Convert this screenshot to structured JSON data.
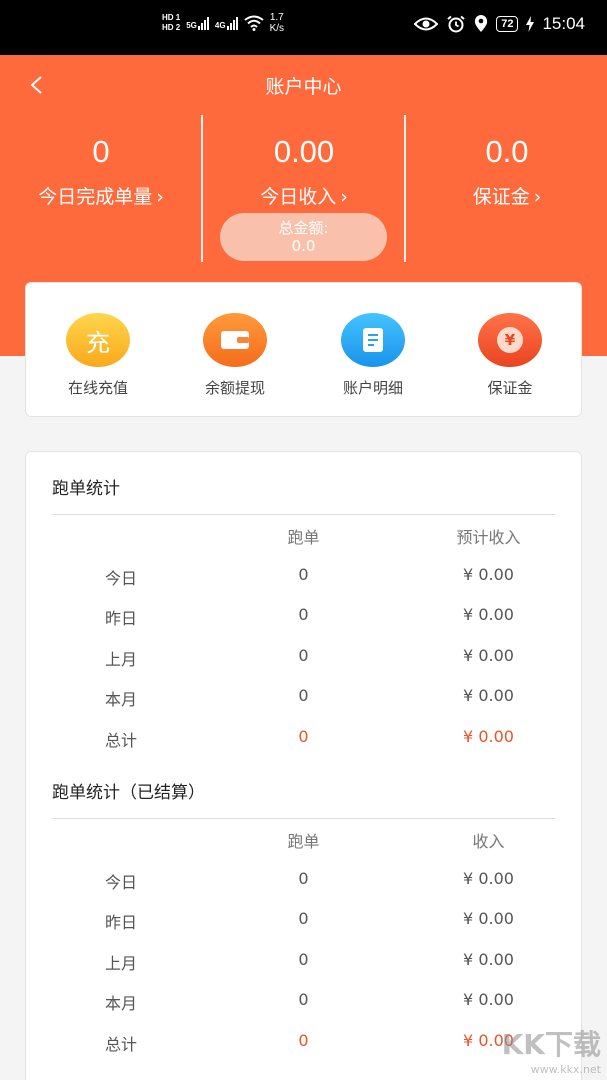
{
  "status_bar": {
    "hd1": "HD 1",
    "hd2": "HD 2",
    "net1": "5G",
    "net2": "4G",
    "speed_value": "1.7",
    "speed_unit": "K/s",
    "battery": "72",
    "time": "15:04"
  },
  "header": {
    "title": "账户中心",
    "accent_color": "#fe6a3c",
    "stats": [
      {
        "value": "0",
        "label": "今日完成单量"
      },
      {
        "value": "0.00",
        "label": "今日收入"
      },
      {
        "value": "0.0",
        "label": "保证金"
      }
    ],
    "total_label": "总金额:",
    "total_value": "0.0"
  },
  "actions": [
    {
      "label": "在线充值",
      "icon": "recharge-icon",
      "glyph": "充"
    },
    {
      "label": "余额提现",
      "icon": "wallet-icon"
    },
    {
      "label": "账户明细",
      "icon": "document-icon"
    },
    {
      "label": "保证金",
      "icon": "yen-icon",
      "glyph": "¥"
    }
  ],
  "stats_section": {
    "title": "跑单统计",
    "headers": [
      "跑单",
      "预计收入"
    ],
    "rows": [
      {
        "label": "今日",
        "count": "0",
        "income": "¥  0.00"
      },
      {
        "label": "昨日",
        "count": "0",
        "income": "¥  0.00"
      },
      {
        "label": "上月",
        "count": "0",
        "income": "¥  0.00"
      },
      {
        "label": "本月",
        "count": "0",
        "income": "¥  0.00"
      },
      {
        "label": "总计",
        "count": "0",
        "income": "¥  0.00"
      }
    ]
  },
  "settled_section": {
    "title": "跑单统计（已结算）",
    "headers": [
      "跑单",
      "收入"
    ],
    "rows": [
      {
        "label": "今日",
        "count": "0",
        "income": "¥  0.00"
      },
      {
        "label": "昨日",
        "count": "0",
        "income": "¥  0.00"
      },
      {
        "label": "上月",
        "count": "0",
        "income": "¥  0.00"
      },
      {
        "label": "本月",
        "count": "0",
        "income": "¥  0.00"
      },
      {
        "label": "总计",
        "count": "0",
        "income": "¥  0.00"
      }
    ]
  },
  "watermark": {
    "text": "KK下载",
    "url": "www.kkx.net"
  }
}
